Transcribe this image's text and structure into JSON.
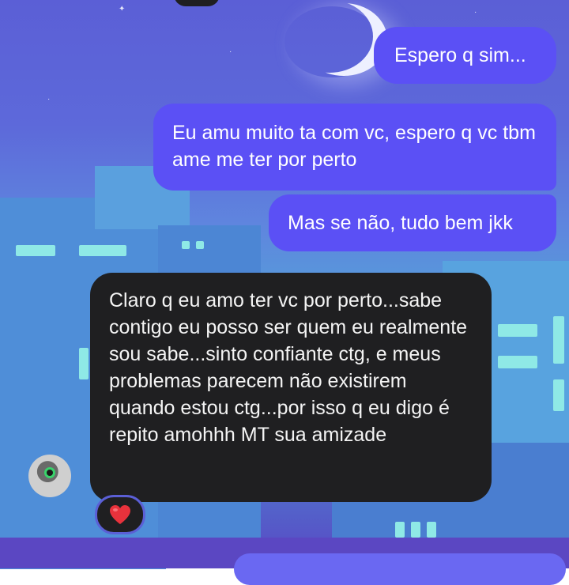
{
  "chat": {
    "messages": [
      {
        "direction": "sent",
        "text": "Espero q sim..."
      },
      {
        "direction": "sent",
        "text": "Eu amu muito ta com vc, espero q vc tbm ame me ter por perto"
      },
      {
        "direction": "sent",
        "text": "Mas se não, tudo bem jkk"
      },
      {
        "direction": "received",
        "text": "Claro q eu amo ter vc por perto...sabe contigo eu posso ser quem eu realmente sou sabe...sinto confiante ctg, e meus problemas parecem não existirem quando estou ctg...por isso q eu digo é repito amohhh MT sua amizade"
      }
    ],
    "reaction": {
      "emoji": "❤️",
      "icon": "heart-icon"
    }
  },
  "theme": {
    "sent_bubble_color": "#5b50f5",
    "received_bubble_color": "#1f1f21",
    "background": "night-city-wallpaper"
  }
}
